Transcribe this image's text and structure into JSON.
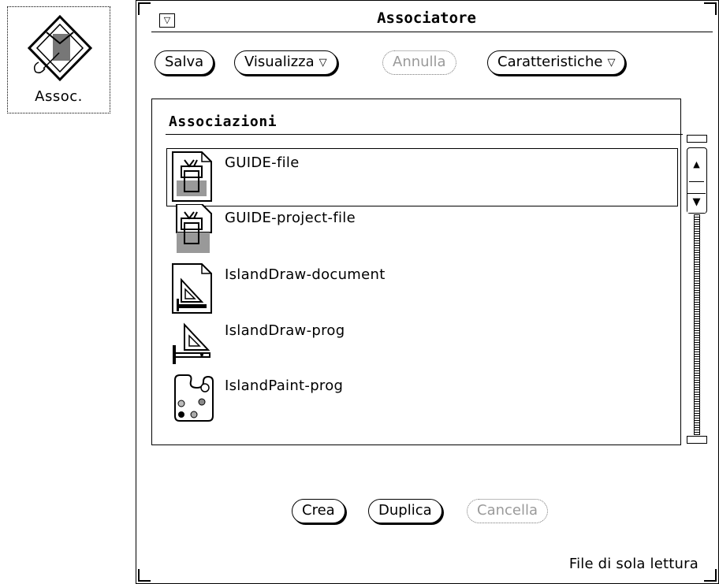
{
  "desktop_icon": {
    "caption": "Assoc.",
    "icon": "binder-icon"
  },
  "window": {
    "title": "Associatore",
    "menu_glyph": "▽",
    "toolbar": {
      "save_label": "Salva",
      "view_label": "Visualizza",
      "undo_label": "Annulla",
      "props_label": "Caratteristiche",
      "menu_arrow": "▽"
    },
    "list": {
      "heading": "Associazioni",
      "items": [
        {
          "label": "GUIDE-file",
          "icon": "guide-file-icon",
          "selected": true
        },
        {
          "label": "GUIDE-project-file",
          "icon": "guide-project-icon",
          "selected": false
        },
        {
          "label": "IslandDraw-document",
          "icon": "draw-document-icon",
          "selected": false
        },
        {
          "label": "IslandDraw-prog",
          "icon": "draw-prog-icon",
          "selected": false
        },
        {
          "label": "IslandPaint-prog",
          "icon": "paint-prog-icon",
          "selected": false
        }
      ]
    },
    "actions": {
      "create_label": "Crea",
      "duplicate_label": "Duplica",
      "delete_label": "Cancella"
    },
    "status": "File di sola lettura"
  }
}
